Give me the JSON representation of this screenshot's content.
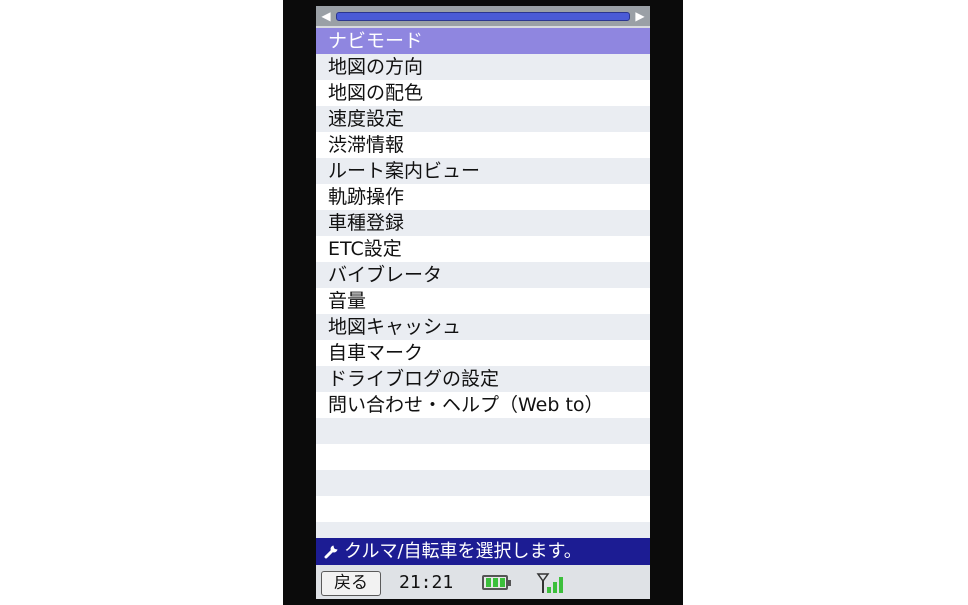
{
  "menu": {
    "items": [
      "ナビモード",
      "地図の方向",
      "地図の配色",
      "速度設定",
      "渋滞情報",
      "ルート案内ビュー",
      "軌跡操作",
      "車種登録",
      "ETC設定",
      "バイブレータ",
      "音量",
      "地図キャッシュ",
      "自車マーク",
      "ドライブログの設定",
      "問い合わせ・ヘルプ（Web to）"
    ],
    "selected_index": 0
  },
  "hint": {
    "icon": "wrench-icon",
    "text": "クルマ/自転車を選択します。"
  },
  "status": {
    "back_label": "戻る",
    "time": "21:21",
    "battery_icon": "battery-icon",
    "signal_icon": "signal-icon"
  },
  "colors": {
    "selected": "#8f86e0",
    "hint_bar": "#1c1c93",
    "scroll_thumb": "#4a5bd6"
  }
}
